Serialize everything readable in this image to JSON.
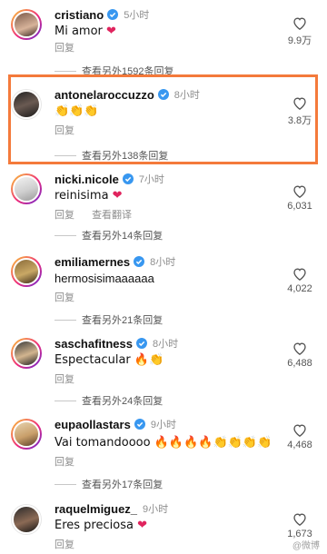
{
  "comments": [
    {
      "username": "cristiano",
      "time": "5小时",
      "text": "Mi amor ❤",
      "reply_label": "回复",
      "likes": "9.9万",
      "view_replies": "查看另外1592条回复"
    },
    {
      "username": "antonelaroccuzzo",
      "time": "8小时",
      "text": "👏👏👏",
      "reply_label": "回复",
      "likes": "3.8万",
      "view_replies": "查看另外138条回复"
    },
    {
      "username": "nicki.nicole",
      "time": "7小时",
      "text": "reinisima ❤",
      "reply_label": "回复",
      "translate_label": "查看翻译",
      "likes": "6,031",
      "view_replies": "查看另外14条回复"
    },
    {
      "username": "emiliamernes",
      "time": "8小时",
      "text": "hermosisimaaaaaa",
      "reply_label": "回复",
      "likes": "4,022",
      "view_replies": "查看另外21条回复"
    },
    {
      "username": "saschafitness",
      "time": "8小时",
      "text": "Espectacular 🔥👏",
      "reply_label": "回复",
      "likes": "6,488",
      "view_replies": "查看另外24条回复"
    },
    {
      "username": "eupaollastars",
      "time": "9小时",
      "text": "Vai tomandoooo 🔥🔥🔥🔥👏👏👏👏",
      "reply_label": "回复",
      "likes": "4,468",
      "view_replies": "查看另外17条回复"
    },
    {
      "username": "raquelmiguez_",
      "time": "9小时",
      "text": "Eres preciosa ❤",
      "reply_label": "回复",
      "likes": "1,673"
    }
  ],
  "colors": {
    "highlight": "#f47a3b",
    "verified": "#3897f0",
    "heart": "#e0245e"
  },
  "watermark": "@微博"
}
